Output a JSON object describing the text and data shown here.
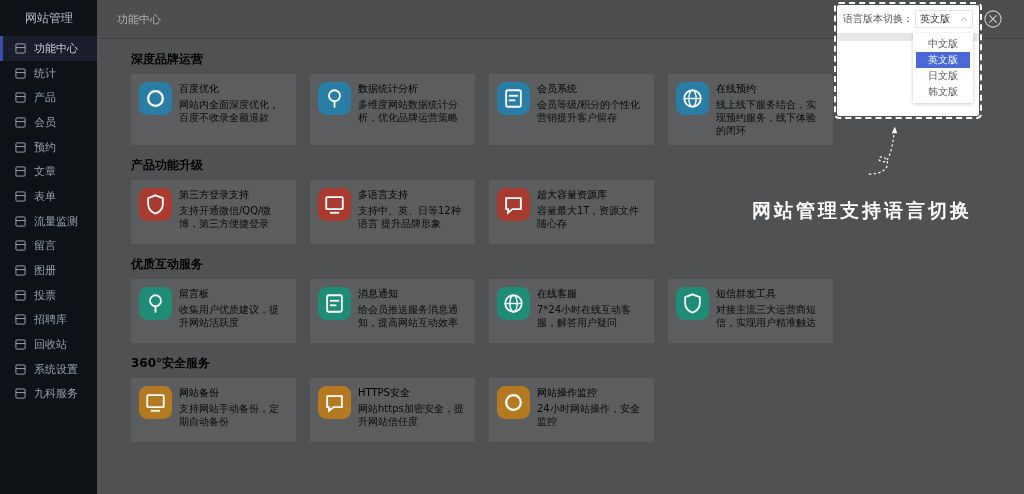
{
  "sidebar": {
    "title": "网站管理",
    "items": [
      {
        "label": "功能中心",
        "selected": true
      },
      {
        "label": "统计",
        "selected": false
      },
      {
        "label": "产品",
        "selected": false
      },
      {
        "label": "会员",
        "selected": false
      },
      {
        "label": "预约",
        "selected": false
      },
      {
        "label": "文章",
        "selected": false
      },
      {
        "label": "表单",
        "selected": false
      },
      {
        "label": "流量监测",
        "selected": false
      },
      {
        "label": "留言",
        "selected": false
      },
      {
        "label": "图册",
        "selected": false
      },
      {
        "label": "投票",
        "selected": false
      },
      {
        "label": "招聘库",
        "selected": false
      },
      {
        "label": "回收站",
        "selected": false
      },
      {
        "label": "系统设置",
        "selected": false
      },
      {
        "label": "九科服务",
        "selected": false
      }
    ]
  },
  "header": {
    "title": "功能中心"
  },
  "sections": [
    {
      "title": "深度品牌运营",
      "cards": [
        {
          "title": "百度优化",
          "desc": "网站内全面深度优化，百度不收录全额退款",
          "color": "#2a7ea6"
        },
        {
          "title": "数据统计分析",
          "desc": "多维度网站数据统计分析，优化品牌运营策略",
          "color": "#2a7ea6"
        },
        {
          "title": "会员系统",
          "desc": "会员等级/积分的个性化营销提升客户留存",
          "color": "#2a7ea6"
        },
        {
          "title": "在线预约",
          "desc": "线上线下服务结合，实现预约服务，线下体验的闭环",
          "color": "#2a7ea6"
        }
      ]
    },
    {
      "title": "产品功能升级",
      "cards": [
        {
          "title": "第三方登录支持",
          "desc": "支持开通微信/QQ/微博，第三方便捷登录",
          "color": "#a83a30"
        },
        {
          "title": "多语言支持",
          "desc": "支持中、英、日等12种语言 提升品牌形象",
          "color": "#a83a30"
        },
        {
          "title": "超大容量资源库",
          "desc": "容量最大1T，资源文件随心存",
          "color": "#a83a30"
        }
      ]
    },
    {
      "title": "优质互动服务",
      "cards": [
        {
          "title": "留言板",
          "desc": "收集用户优质建议，提升网站活跃度",
          "color": "#1f8c78"
        },
        {
          "title": "消息通知",
          "desc": "给会员推送服务消息通知，提高网站互动效率",
          "color": "#1f8c78"
        },
        {
          "title": "在线客服",
          "desc": "7*24小时在线互动客服，解答用户疑问",
          "color": "#1f8c78"
        },
        {
          "title": "短信群发工具",
          "desc": "对接主流三大运营商短信，实现用户精准触达",
          "color": "#1f8c78"
        }
      ]
    },
    {
      "title": "360°安全服务",
      "cards": [
        {
          "title": "网站备份",
          "desc": "支持网站手动备份，定期自动备份",
          "color": "#b47a22"
        },
        {
          "title": "HTTPS安全",
          "desc": "网站https加密安全，提升网站信任度",
          "color": "#b47a22"
        },
        {
          "title": "网站操作监控",
          "desc": "24小时网站操作，安全监控",
          "color": "#b47a22"
        }
      ]
    }
  ],
  "language_popup": {
    "label": "语言版本切换：",
    "value": "英文版",
    "options": [
      {
        "label": "中文版",
        "selected": false
      },
      {
        "label": "英文版",
        "selected": true
      },
      {
        "label": "日文版",
        "selected": false
      },
      {
        "label": "韩文版",
        "selected": false
      }
    ]
  },
  "annotation": "网站管理支持语言切换"
}
